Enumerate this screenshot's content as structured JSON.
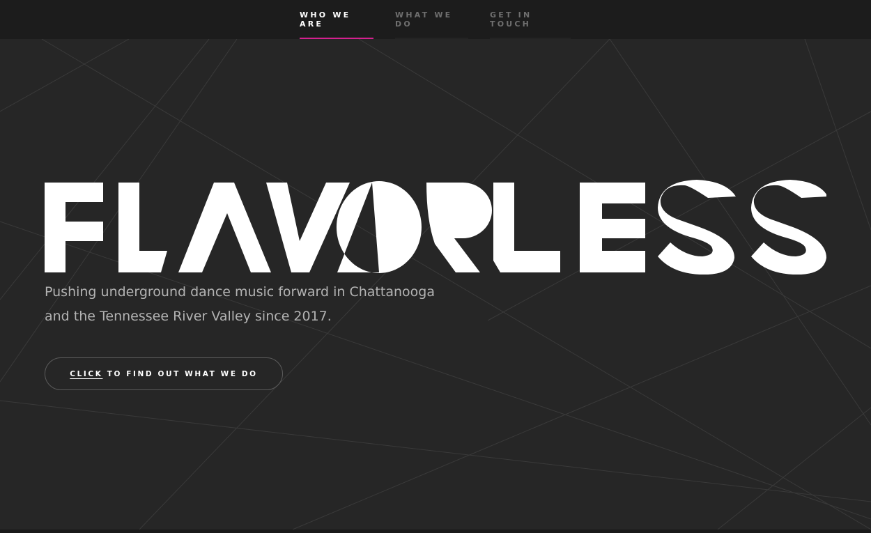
{
  "nav": {
    "items": [
      {
        "label": "WHO WE ARE",
        "active": true
      },
      {
        "label": "WHAT WE DO",
        "active": false
      },
      {
        "label": "GET IN TOUCH",
        "active": false
      }
    ]
  },
  "hero": {
    "logo_text": "FLAVORLESS",
    "tagline_line1": "Pushing underground dance music forward in Chattanooga",
    "tagline_line2": "and the Tennessee River Valley since 2017.",
    "cta": {
      "emphasis": "CLICK",
      "rest": "TO FIND OUT WHAT WE DO"
    }
  },
  "colors": {
    "background": "#262626",
    "nav_background": "#1c1c1c",
    "accent": "#d4218f",
    "text_muted": "#b3b3b3",
    "nav_inactive": "#6f6f6f"
  }
}
